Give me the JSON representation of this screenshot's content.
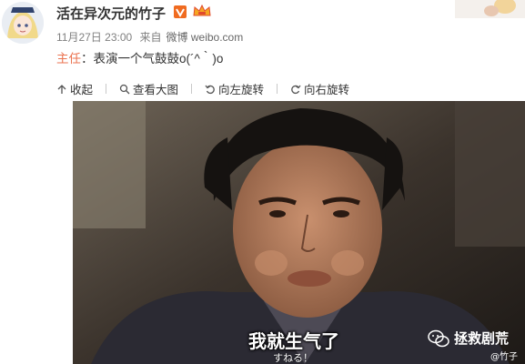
{
  "post": {
    "username": "活在异次元的竹子",
    "timestamp": "11月27日 23:00",
    "source_prefix": "来自",
    "source": "微博 weibo.com",
    "host_label": "主任",
    "separator": "：",
    "content": "表演一个气鼓鼓o(´^｀)o"
  },
  "toolbar": {
    "collapse_label": "收起",
    "view_large_label": "查看大图",
    "rotate_left_label": "向左旋转",
    "rotate_right_label": "向右旋转"
  },
  "image": {
    "subtitle_cn": "我就生气了",
    "subtitle_jp": "すねる！",
    "watermark": "拯救剧荒",
    "watermark_sub": "@竹子"
  },
  "colors": {
    "host_label": "#eb7350",
    "meta": "#808080",
    "badge": "#f06b20"
  },
  "icons": [
    "collapse-icon",
    "zoom-icon",
    "rotate-left-icon",
    "rotate-right-icon",
    "vip-icon",
    "crown-icon",
    "wechat-icon"
  ]
}
